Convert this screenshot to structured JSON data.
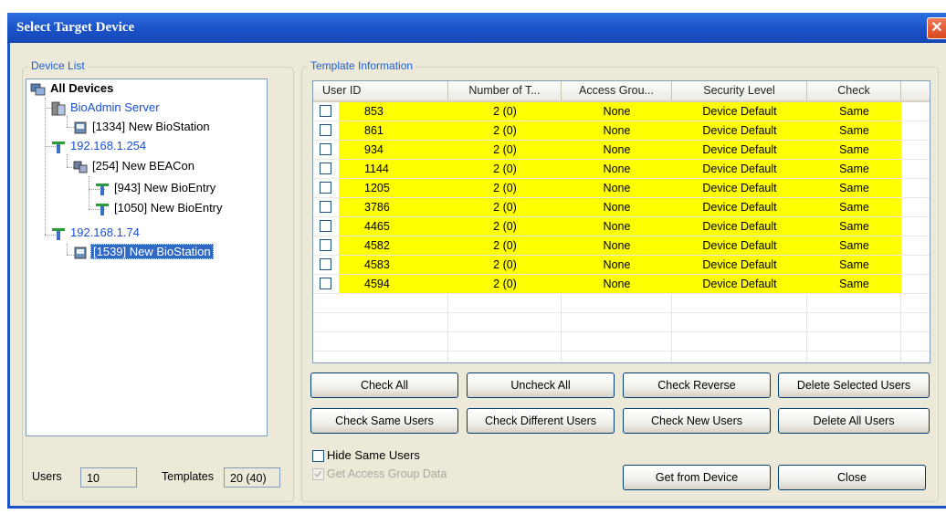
{
  "window": {
    "title": "Select Target Device",
    "close_glyph": "✕"
  },
  "device_list": {
    "label": "Device List",
    "tree": [
      {
        "label": "All Devices",
        "icon": "all-devices-icon"
      },
      {
        "label": "BioAdmin Server",
        "icon": "server-icon"
      },
      {
        "label": "[1334] New BioStation",
        "icon": "biostation-icon"
      },
      {
        "label": "192.168.1.254",
        "icon": "network-icon"
      },
      {
        "label": "[254] New BEACon",
        "icon": "beacon-icon"
      },
      {
        "label": "[943] New BioEntry",
        "icon": "bioentry-icon"
      },
      {
        "label": "[1050] New BioEntry",
        "icon": "bioentry-icon"
      },
      {
        "label": "192.168.1.74",
        "icon": "network-icon"
      },
      {
        "label": "[1539] New BioStation",
        "icon": "biostation-icon"
      }
    ],
    "users_label": "Users",
    "users_value": "10",
    "templates_label": "Templates",
    "templates_value": "20 (40)"
  },
  "template_info": {
    "label": "Template Information",
    "columns": [
      "User ID",
      "Number of T...",
      "Access Grou...",
      "Security Level",
      "Check"
    ],
    "rows": [
      [
        "853",
        "2 (0)",
        "None",
        "Device Default",
        "Same"
      ],
      [
        "861",
        "2 (0)",
        "None",
        "Device Default",
        "Same"
      ],
      [
        "934",
        "2 (0)",
        "None",
        "Device Default",
        "Same"
      ],
      [
        "1144",
        "2 (0)",
        "None",
        "Device Default",
        "Same"
      ],
      [
        "1205",
        "2 (0)",
        "None",
        "Device Default",
        "Same"
      ],
      [
        "3786",
        "2 (0)",
        "None",
        "Device Default",
        "Same"
      ],
      [
        "4465",
        "2 (0)",
        "None",
        "Device Default",
        "Same"
      ],
      [
        "4582",
        "2 (0)",
        "None",
        "Device Default",
        "Same"
      ],
      [
        "4583",
        "2 (0)",
        "None",
        "Device Default",
        "Same"
      ],
      [
        "4594",
        "2 (0)",
        "None",
        "Device Default",
        "Same"
      ]
    ],
    "highlight_color": "#ffff00",
    "buttons": {
      "check_all": "Check All",
      "uncheck_all": "Uncheck All",
      "check_reverse": "Check Reverse",
      "delete_selected": "Delete Selected Users",
      "check_same": "Check Same Users",
      "check_different": "Check Different Users",
      "check_new": "Check New Users",
      "delete_all": "Delete All Users",
      "get_from_device": "Get from Device",
      "close": "Close"
    },
    "hide_same_users": "Hide Same Users",
    "get_access_group": "Get Access Group Data"
  }
}
